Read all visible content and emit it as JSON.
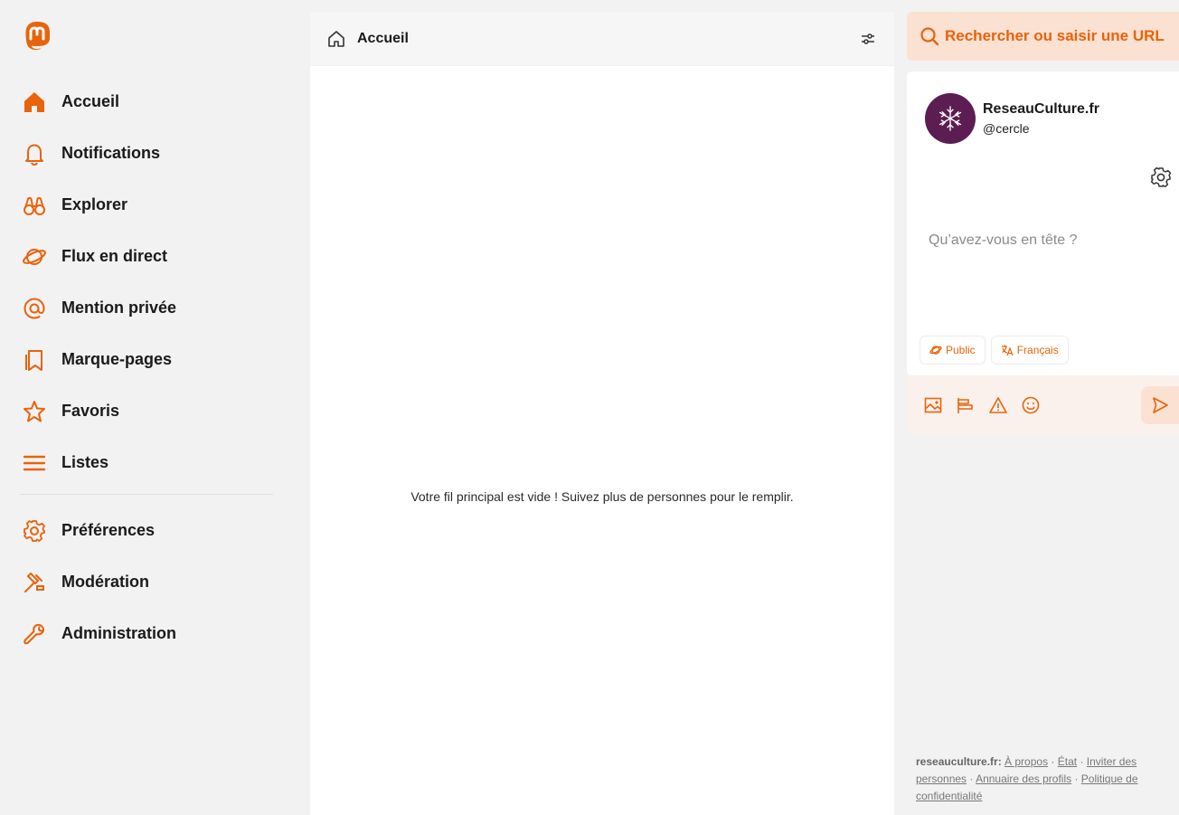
{
  "colors": {
    "accent": "#e8630a",
    "search_bg": "#fbe1d2",
    "avatar_bg": "#5c1d52"
  },
  "nav": {
    "logo": "mastodon-logo-icon",
    "items": [
      {
        "label": "Accueil",
        "icon": "home-icon"
      },
      {
        "label": "Notifications",
        "icon": "bell-icon"
      },
      {
        "label": "Explorer",
        "icon": "binoculars-icon"
      },
      {
        "label": "Flux en direct",
        "icon": "planet-icon"
      },
      {
        "label": "Mention privée",
        "icon": "at-icon"
      },
      {
        "label": "Marque-pages",
        "icon": "bookmarks-icon"
      },
      {
        "label": "Favoris",
        "icon": "star-icon"
      },
      {
        "label": "Listes",
        "icon": "list-icon"
      }
    ],
    "admin_items": [
      {
        "label": "Préférences",
        "icon": "gear-icon"
      },
      {
        "label": "Modération",
        "icon": "gavel-icon"
      },
      {
        "label": "Administration",
        "icon": "wrench-icon"
      }
    ]
  },
  "main": {
    "title": "Accueil",
    "empty_message": "Votre fil principal est vide ! Suivez plus de personnes pour le remplir."
  },
  "search": {
    "placeholder": "Rechercher ou saisir une URL"
  },
  "compose": {
    "account_name": "ReseauCulture.fr",
    "account_handle": "@cercle",
    "placeholder": "Qu’avez-vous en tête ?",
    "visibility": "Public",
    "language": "Français"
  },
  "footer": {
    "site": "reseauculture.fr:",
    "links": [
      "À propos",
      "État",
      "Inviter des personnes",
      "Annuaire des profils",
      "Politique de confidentialité"
    ]
  }
}
